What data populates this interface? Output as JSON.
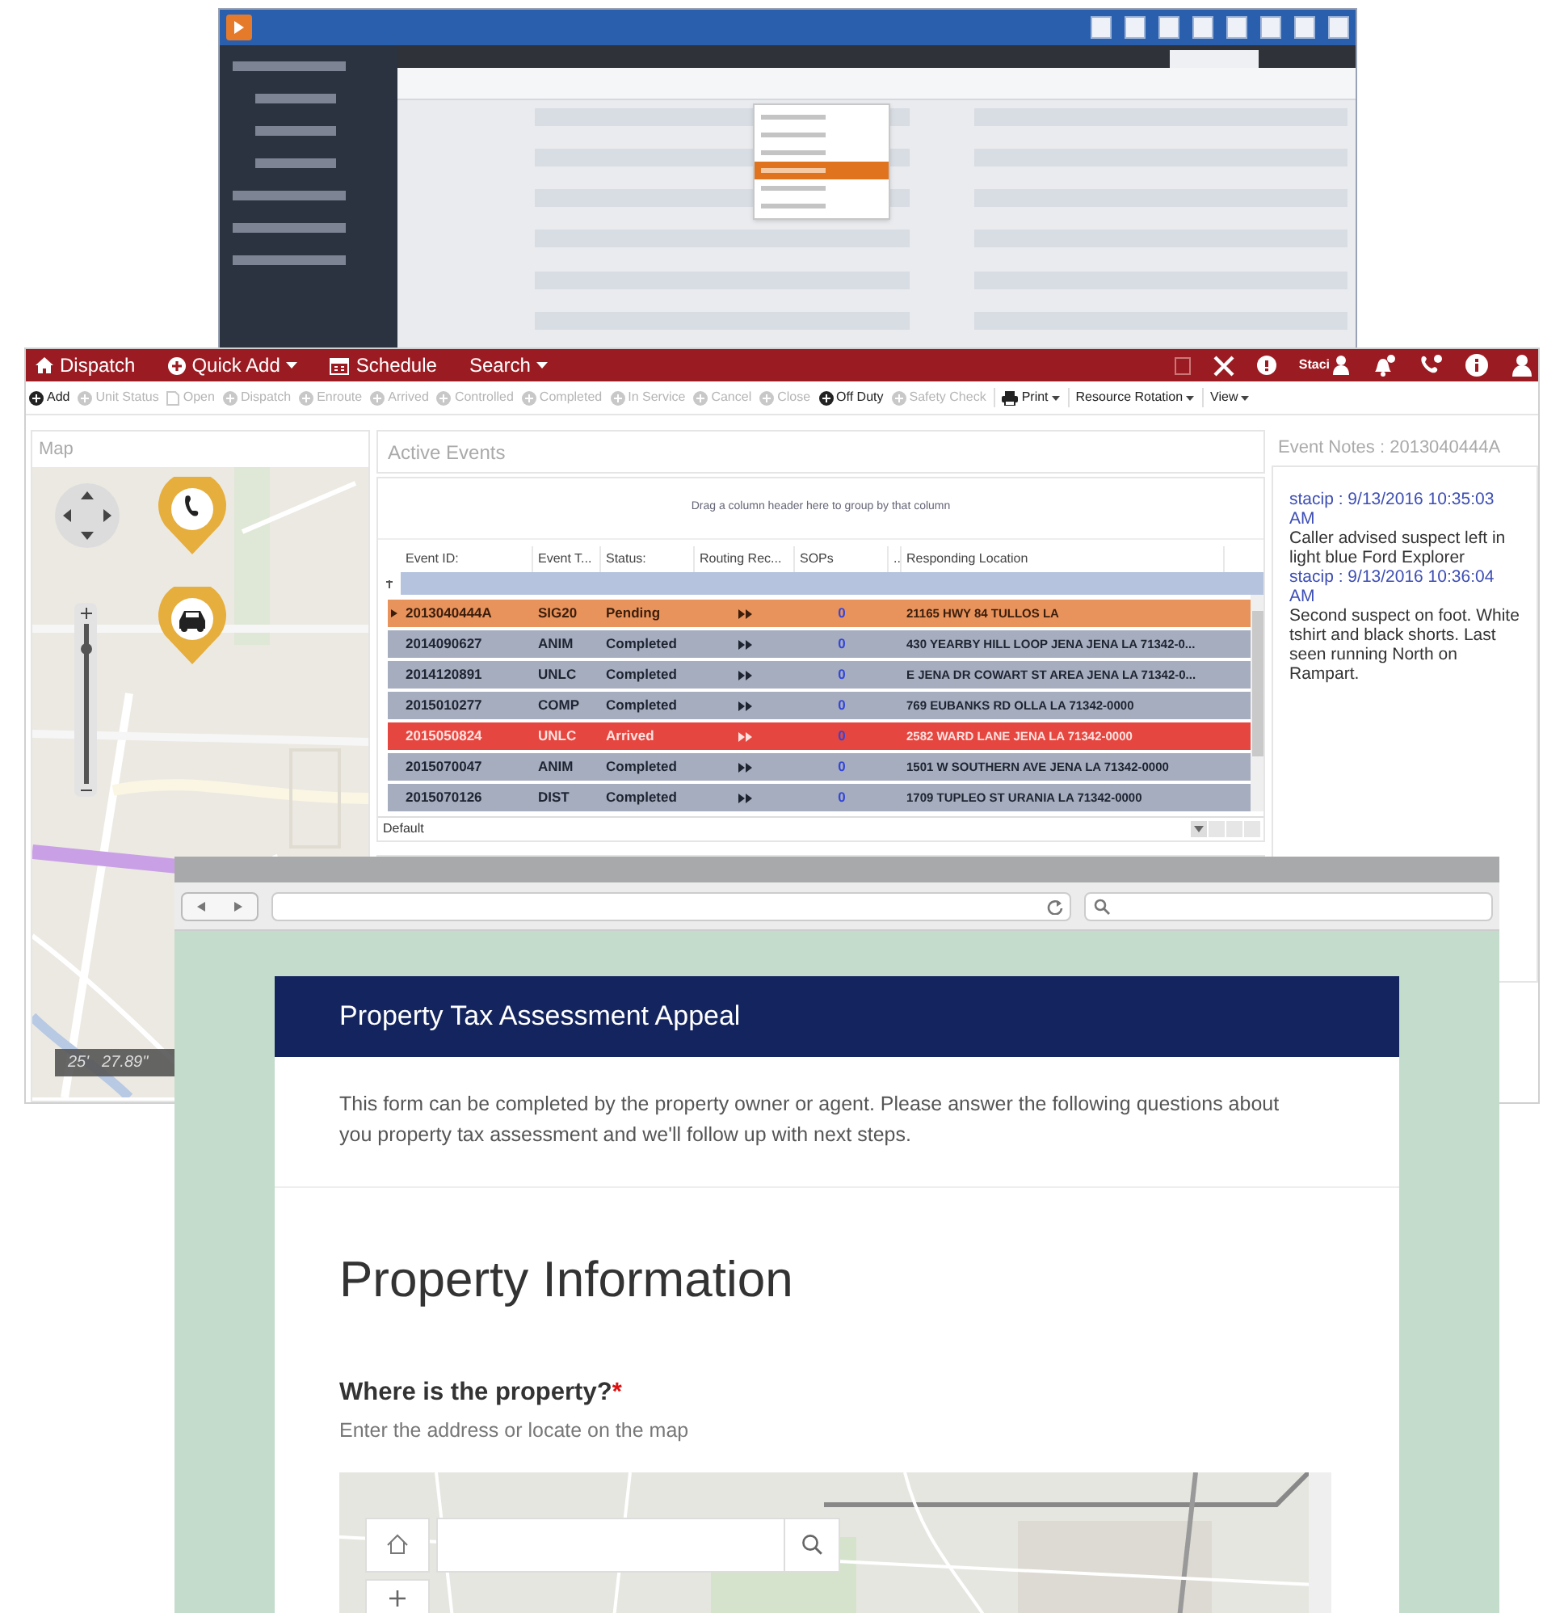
{
  "back_window": {
    "menu_items": [
      {
        "selected": false
      },
      {
        "selected": false
      },
      {
        "selected": false
      },
      {
        "selected": true
      },
      {
        "selected": false
      },
      {
        "selected": false
      }
    ]
  },
  "dispatch_window": {
    "nav": [
      {
        "label": "Dispatch",
        "caret": false
      },
      {
        "label": "Quick Add",
        "caret": true
      },
      {
        "label": "Schedule",
        "caret": false
      },
      {
        "label": "Search",
        "caret": true
      }
    ],
    "user": "Staci",
    "toolbar": [
      {
        "label": "Add",
        "kind": "action",
        "disabled": false
      },
      {
        "label": "Unit Status",
        "kind": "action",
        "disabled": true
      },
      {
        "label": "Open",
        "kind": "doc",
        "disabled": true
      },
      {
        "label": "Dispatch",
        "kind": "action",
        "disabled": true
      },
      {
        "label": "Enroute",
        "kind": "action",
        "disabled": true
      },
      {
        "label": "Arrived",
        "kind": "action",
        "disabled": true
      },
      {
        "label": "Controlled",
        "kind": "action",
        "disabled": true
      },
      {
        "label": "Completed",
        "kind": "action",
        "disabled": true
      },
      {
        "label": "In Service",
        "kind": "action",
        "disabled": true
      },
      {
        "label": "Cancel",
        "kind": "action",
        "disabled": true
      },
      {
        "label": "Close",
        "kind": "action",
        "disabled": true
      },
      {
        "label": "Off Duty",
        "kind": "action",
        "disabled": false
      },
      {
        "label": "Safety Check",
        "kind": "action",
        "disabled": true
      },
      {
        "label": "Print",
        "kind": "print",
        "disabled": false
      },
      {
        "label": "Resource Rotation",
        "kind": "menu",
        "disabled": false
      },
      {
        "label": "View",
        "kind": "menu",
        "disabled": false
      }
    ],
    "map": {
      "title": "Map",
      "zoom": {
        "level": 0.85
      },
      "scale": [
        "25'",
        "27.89\""
      ]
    },
    "events": {
      "title": "Active Events",
      "group_hint": "Drag a column header here to group by that column",
      "columns": [
        "Event ID:",
        "Event T...",
        "Status:",
        "Routing Rec...",
        "SOPs",
        "..",
        "Responding Location"
      ],
      "rows": [
        {
          "kind": "pending",
          "selected": true,
          "cells": [
            "2013040444A",
            "SIG20",
            "Pending",
            "0",
            "21165 HWY 84 TULLOS LA"
          ]
        },
        {
          "kind": "completed",
          "selected": false,
          "cells": [
            "2014090627",
            "ANIM",
            "Completed",
            "0",
            "430 YEARBY HILL LOOP  JENA JENA LA 71342-0..."
          ]
        },
        {
          "kind": "completed",
          "selected": false,
          "cells": [
            "2014120891",
            "UNLC",
            "Completed",
            "0",
            "E JENA DR COWART ST AREA JENA LA 71342-0..."
          ]
        },
        {
          "kind": "completed",
          "selected": false,
          "cells": [
            "2015010277",
            "COMP",
            "Completed",
            "0",
            "769 EUBANKS RD OLLA LA 71342-0000"
          ]
        },
        {
          "kind": "arrived",
          "selected": false,
          "cells": [
            "2015050824",
            "UNLC",
            "Arrived",
            "0",
            "2582 WARD LANE JENA LA 71342-0000"
          ]
        },
        {
          "kind": "completed",
          "selected": false,
          "cells": [
            "2015070047",
            "ANIM",
            "Completed",
            "0",
            "1501 W SOUTHERN AVE JENA LA 71342-0000"
          ]
        },
        {
          "kind": "completed",
          "selected": false,
          "cells": [
            "2015070126",
            "DIST",
            "Completed",
            "0",
            "1709 TUPLEO ST URANIA LA 71342-0000"
          ]
        }
      ],
      "layout": "Default"
    },
    "notes": {
      "title": "Event Notes : 2013040444A",
      "entries": [
        {
          "author": "stacip : 9/13/2016 10:35:03 AM",
          "text": "Caller advised suspect left in light blue Ford Explorer"
        },
        {
          "author": "stacip : 9/13/2016 10:36:04 AM",
          "text": "Second suspect on foot. White tshirt and black shorts. Last seen running North on Rampart."
        }
      ]
    }
  },
  "browser": {
    "form": {
      "title": "Property Tax Assessment Appeal",
      "description": "This form can be completed by the property owner or agent. Please answer the following questions about you property tax assessment and we'll follow up with next steps.",
      "section": "Property Information",
      "question": "Where is the property?",
      "required_mark": "*",
      "hint": "Enter the address or locate on the map"
    }
  }
}
